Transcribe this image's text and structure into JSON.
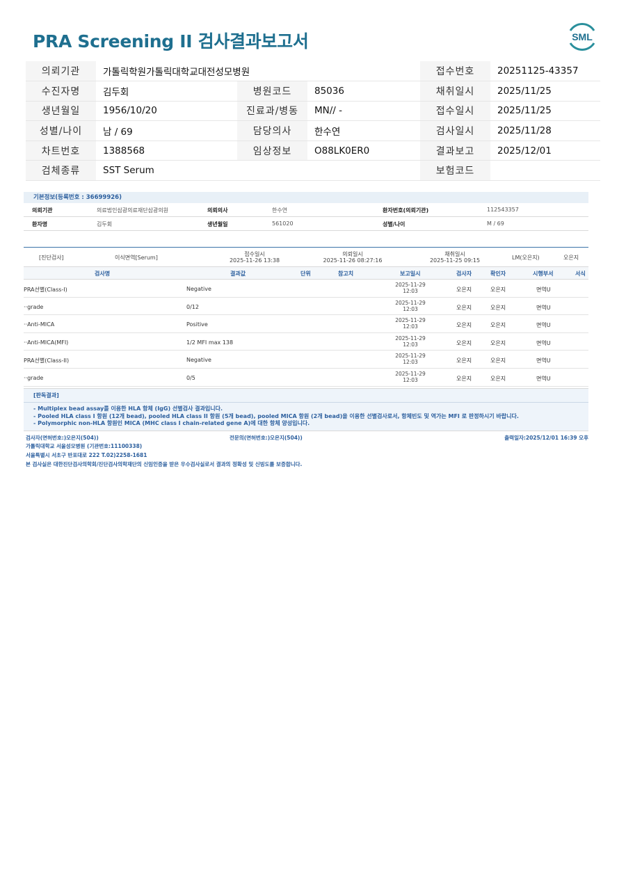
{
  "title": "PRA Screening II 검사결과보고서",
  "logo_text": "SML",
  "header": {
    "rows": [
      [
        {
          "label": "의뢰기관",
          "value": "가톨릭학원가톨릭대학교대전성모병원",
          "span": 3
        },
        {
          "label": "접수번호",
          "value": "20251125-43357"
        }
      ],
      [
        {
          "label": "수진자명",
          "value": "김두회"
        },
        {
          "label": "병원코드",
          "value": "85036"
        },
        {
          "label": "채취일시",
          "value": "2025/11/25"
        }
      ],
      [
        {
          "label": "생년월일",
          "value": "1956/10/20"
        },
        {
          "label": "진료과/병동",
          "value": "MN// -"
        },
        {
          "label": "접수일시",
          "value": "2025/11/25"
        }
      ],
      [
        {
          "label": "성별/나이",
          "value": "남 / 69"
        },
        {
          "label": "담당의사",
          "value": "한수연"
        },
        {
          "label": "검사일시",
          "value": "2025/11/28"
        }
      ],
      [
        {
          "label": "차트번호",
          "value": "1388568"
        },
        {
          "label": "임상정보",
          "value": "O88LK0ER0"
        },
        {
          "label": "결과보고",
          "value": "2025/12/01"
        }
      ],
      [
        {
          "label": "검체종류",
          "value": "SST Serum",
          "span": 3
        },
        {
          "label": "보험코드",
          "value": ""
        }
      ]
    ]
  },
  "basic_info": {
    "title": "기본정보(등록번호 : 36699926)",
    "rows": [
      {
        "k1": "의뢰기관",
        "v1": "의료법인삼광의료재단삼광의원",
        "k2": "의뢰의사",
        "v2": "한수연",
        "k3": "환자번호(의뢰기관)",
        "v3": "112543357"
      },
      {
        "k1": "환자명",
        "v1": "김두회",
        "k2": "생년월일",
        "v2": "561020",
        "k3": "성별/나이",
        "v3": "M / 69"
      }
    ]
  },
  "diag": {
    "top": {
      "kind": "[진단검사]",
      "specimen": "이식면역[Serum]",
      "recv_label": "접수일시",
      "recv_value": "2025-11-26 13:38",
      "req_label": "의뢰일시",
      "req_value": "2025-11-26 08:27:16",
      "coll_label": "채취일시",
      "coll_value": "2025-11-25 09:15",
      "lm": "LM(오은지)",
      "person": "오은지"
    },
    "columns": [
      "검사명",
      "결과값",
      "단위",
      "참고치",
      "보고일시",
      "검사자",
      "확인자",
      "시행부서",
      "서식"
    ],
    "rows": [
      {
        "name": "PRA선별(Class-I)",
        "result": "Negative",
        "date": "2025-11-29",
        "time": "12:03",
        "tester": "오은지",
        "checker": "오은지",
        "dept": "면역U"
      },
      {
        "name": "  ··grade",
        "result": "0/12",
        "date": "2025-11-29",
        "time": "12:03",
        "tester": "오은지",
        "checker": "오은지",
        "dept": "면역U"
      },
      {
        "name": "  ··Anti-MICA",
        "result": "Positive",
        "date": "2025-11-29",
        "time": "12:03",
        "tester": "오은지",
        "checker": "오은지",
        "dept": "면역U"
      },
      {
        "name": "  ··Anti-MICA(MFI)",
        "result": "1/2 MFI max 138",
        "date": "2025-11-29",
        "time": "12:03",
        "tester": "오은지",
        "checker": "오은지",
        "dept": "면역U"
      },
      {
        "name": "PRA선별(Class-II)",
        "result": "Negative",
        "date": "2025-11-29",
        "time": "12:03",
        "tester": "오은지",
        "checker": "오은지",
        "dept": "면역U"
      },
      {
        "name": "  ··grade",
        "result": "0/5",
        "date": "2025-11-29",
        "time": "12:03",
        "tester": "오은지",
        "checker": "오은지",
        "dept": "면역U"
      }
    ]
  },
  "judgement": {
    "title": "[판독결과]",
    "lines": [
      "- Multiplex bead assay를 이용한 HLA 항체 (IgG) 선별검사 결과입니다.",
      "- Pooled HLA class I 항원 (12개 bead), pooled HLA class II 항원 (5개 bead), pooled MICA 항원 (2개 bead)을 이용한 선별검사로서, 항체빈도 및 역가는 MFI 로 판정하시기 바랍니다.",
      "- Polymorphic non-HLA 항원인 MICA (MHC class I chain-related gene A)에 대한 항체 양성입니다."
    ]
  },
  "footer": {
    "tester": "검사자(면허번호:)오은지(504))",
    "specialist": "전문의(면허번호:)오은지(504))",
    "printed": "출력일자:2025/12/01 16:39 오후",
    "line2": "가톨릭대학교 서울성모병원 (기관번호:11100338)",
    "line3": "서울특별시 서초구 반포대로 222 T.02)2258-1681",
    "line4": "본 검사실은 대한진단검사의학회/진단검사의학재단의 신임인증을 받은 우수검사실로서 결과의 정확성 및 신빙도를 보증합니다."
  }
}
